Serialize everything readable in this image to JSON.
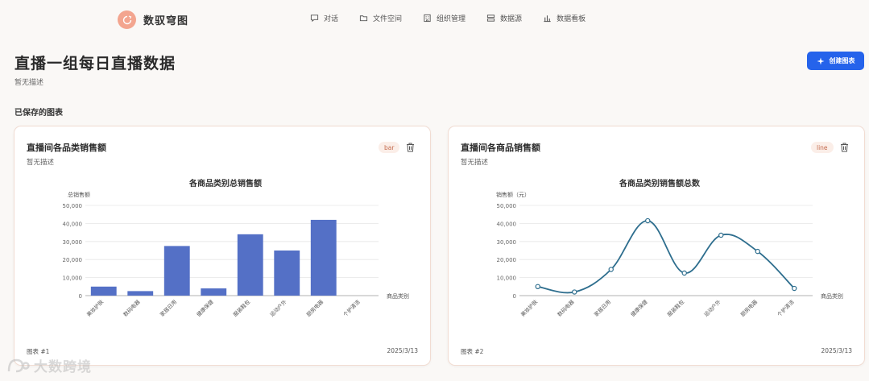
{
  "brand": {
    "name": "数驭穹图"
  },
  "nav": [
    {
      "label": "对话",
      "icon": "chat-icon"
    },
    {
      "label": "文件空间",
      "icon": "folder-icon"
    },
    {
      "label": "组织管理",
      "icon": "org-icon"
    },
    {
      "label": "数据源",
      "icon": "database-icon"
    },
    {
      "label": "数据看板",
      "icon": "bar-chart-icon"
    }
  ],
  "header": {
    "title": "直播一组每日直播数据",
    "desc": "暂无描述",
    "create_label": "创建图表"
  },
  "section": {
    "title": "已保存的图表"
  },
  "cards": [
    {
      "title": "直播间各品类销售额",
      "desc": "暂无描述",
      "type": "bar",
      "footer_left": "图表 #1",
      "footer_right": "2025/3/13"
    },
    {
      "title": "直播间各商品销售额",
      "desc": "暂无描述",
      "type": "line",
      "footer_left": "图表 #2",
      "footer_right": "2025/3/13"
    }
  ],
  "chart_data": [
    {
      "type": "bar",
      "title": "各商品类别总销售额",
      "xlabel": "商品类别",
      "ylabel": "总销售额",
      "categories": [
        "美妆护肤",
        "数码电器",
        "家居日用",
        "健康保健",
        "服装鞋包",
        "运动户外",
        "厨房电器",
        "个护清洁"
      ],
      "values": [
        5000,
        2500,
        27500,
        4000,
        34000,
        25000,
        42000,
        0
      ],
      "ylim": [
        0,
        50000
      ],
      "yticks": [
        "0",
        "10,000",
        "20,000",
        "30,000",
        "40,000",
        "50,000"
      ],
      "color": "#5470c6",
      "grid": true
    },
    {
      "type": "line",
      "title": "各商品类别销售额总数",
      "xlabel": "商品类别",
      "ylabel": "销售额（元）",
      "categories": [
        "美妆护肤",
        "数码电器",
        "家居日用",
        "健康保健",
        "服装鞋包",
        "运动户外",
        "厨房电器",
        "个护清洁"
      ],
      "values": [
        5000,
        2000,
        14500,
        41500,
        12500,
        33500,
        24500,
        4000
      ],
      "ylim": [
        0,
        50000
      ],
      "yticks": [
        "0",
        "10,000",
        "20,000",
        "30,000",
        "40,000",
        "50,000"
      ],
      "color": "#2e6e8e",
      "smooth": true,
      "grid": true
    }
  ],
  "watermark": {
    "text": "大数跨境"
  }
}
